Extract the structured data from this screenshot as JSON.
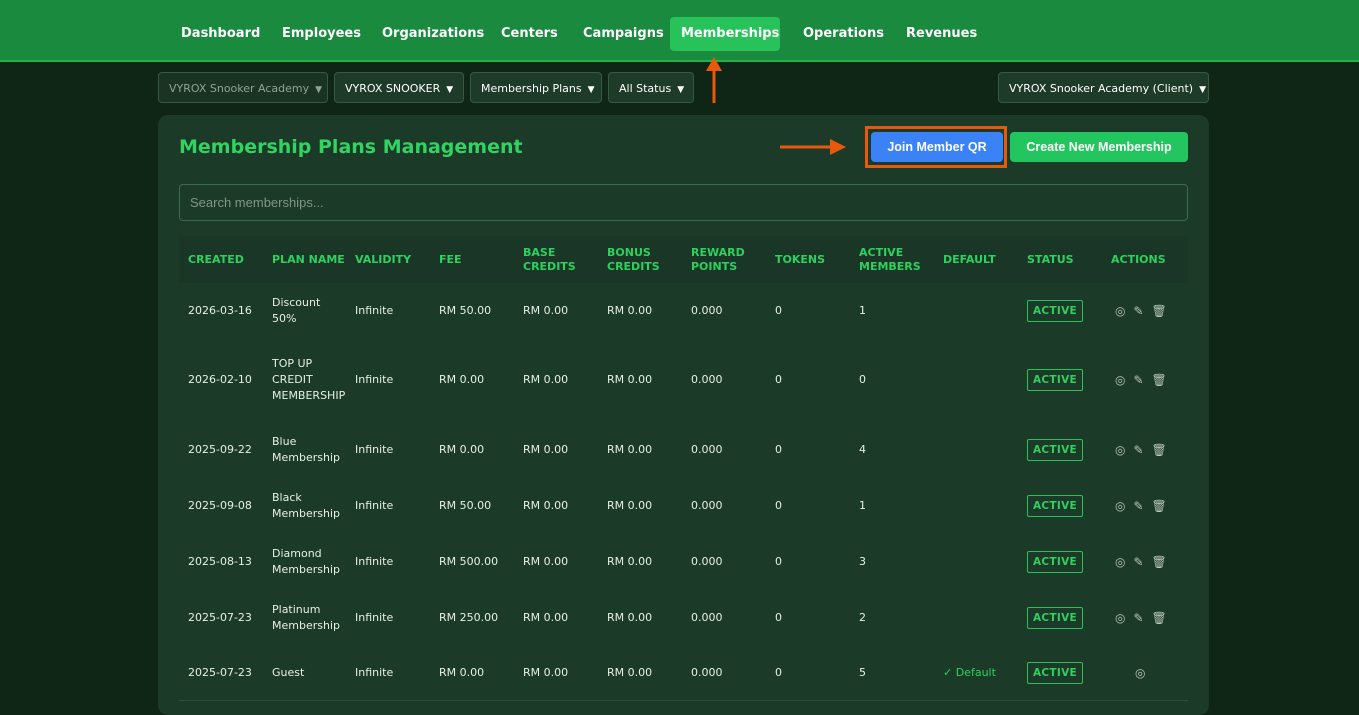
{
  "nav": {
    "items": [
      {
        "label": "Dashboard",
        "active": false
      },
      {
        "label": "Employees",
        "active": false
      },
      {
        "label": "Organizations",
        "active": false
      },
      {
        "label": "Centers",
        "active": false
      },
      {
        "label": "Campaigns",
        "active": false
      },
      {
        "label": "Memberships",
        "active": true
      },
      {
        "label": "Operations",
        "active": false
      },
      {
        "label": "Revenues",
        "active": false
      }
    ]
  },
  "filters": {
    "academy": "VYROX Snooker Academy",
    "center": "VYROX SNOOKER",
    "view": "Membership Plans",
    "status": "All Status",
    "client": "VYROX Snooker Academy (Client)"
  },
  "panel": {
    "title": "Membership Plans Management",
    "join_qr_label": "Join Member QR",
    "create_label": "Create New Membership",
    "search_placeholder": "Search memberships..."
  },
  "table": {
    "headers": [
      "CREATED",
      "PLAN NAME",
      "VALIDITY",
      "FEE",
      "BASE CREDITS",
      "BONUS CREDITS",
      "REWARD POINTS",
      "TOKENS",
      "ACTIVE MEMBERS",
      "DEFAULT",
      "STATUS",
      "ACTIONS"
    ],
    "rows": [
      {
        "created": "2026-03-16",
        "plan": "Discount 50%",
        "validity": "Infinite",
        "fee": "RM 50.00",
        "base": "RM 0.00",
        "bonus": "RM 0.00",
        "reward": "0.000",
        "tokens": "0",
        "active": "1",
        "default": "",
        "status": "ACTIVE"
      },
      {
        "created": "2026-02-10",
        "plan": "TOP UP CREDIT MEMBERSHIP",
        "validity": "Infinite",
        "fee": "RM 0.00",
        "base": "RM 0.00",
        "bonus": "RM 0.00",
        "reward": "0.000",
        "tokens": "0",
        "active": "0",
        "default": "",
        "status": "ACTIVE"
      },
      {
        "created": "2025-09-22",
        "plan": "Blue Membership",
        "validity": "Infinite",
        "fee": "RM 0.00",
        "base": "RM 0.00",
        "bonus": "RM 0.00",
        "reward": "0.000",
        "tokens": "0",
        "active": "4",
        "default": "",
        "status": "ACTIVE"
      },
      {
        "created": "2025-09-08",
        "plan": "Black Membership",
        "validity": "Infinite",
        "fee": "RM 50.00",
        "base": "RM 0.00",
        "bonus": "RM 0.00",
        "reward": "0.000",
        "tokens": "0",
        "active": "1",
        "default": "",
        "status": "ACTIVE"
      },
      {
        "created": "2025-08-13",
        "plan": "Diamond Membership",
        "validity": "Infinite",
        "fee": "RM 500.00",
        "base": "RM 0.00",
        "bonus": "RM 0.00",
        "reward": "0.000",
        "tokens": "0",
        "active": "3",
        "default": "",
        "status": "ACTIVE"
      },
      {
        "created": "2025-07-23",
        "plan": "Platinum Membership",
        "validity": "Infinite",
        "fee": "RM 250.00",
        "base": "RM 0.00",
        "bonus": "RM 0.00",
        "reward": "0.000",
        "tokens": "0",
        "active": "2",
        "default": "",
        "status": "ACTIVE"
      },
      {
        "created": "2025-07-23",
        "plan": "Guest",
        "validity": "Infinite",
        "fee": "RM 0.00",
        "base": "RM 0.00",
        "bonus": "RM 0.00",
        "reward": "0.000",
        "tokens": "0",
        "active": "5",
        "default": "✓ Default",
        "status": "ACTIVE"
      }
    ]
  },
  "colors": {
    "nav_bg": "#1a8a3f",
    "accent_green": "#2fd05f",
    "primary_blue": "#3b82f6",
    "highlight_orange": "#ea580c"
  },
  "icons": [
    "eye-icon",
    "pencil-icon",
    "trash-icon",
    "caret-down-icon"
  ]
}
